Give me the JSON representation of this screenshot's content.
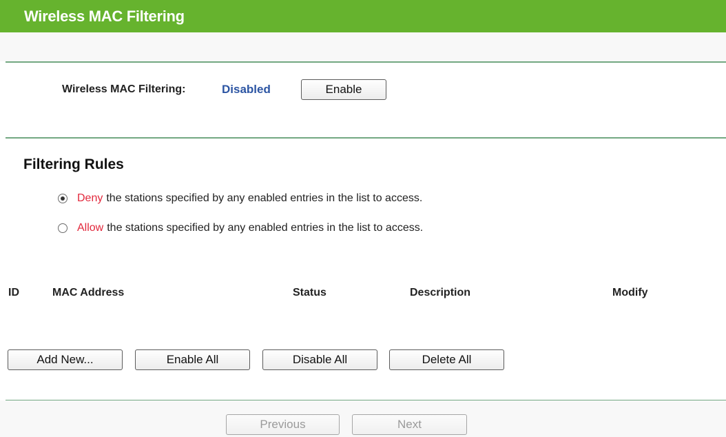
{
  "header": {
    "title": "Wireless MAC Filtering"
  },
  "filtering": {
    "label": "Wireless MAC Filtering:",
    "status": "Disabled",
    "enable_button": "Enable"
  },
  "rules": {
    "title": "Filtering Rules",
    "options": [
      {
        "keyword": "Deny",
        "text": "the stations specified by any enabled entries in the list to access.",
        "selected": true
      },
      {
        "keyword": "Allow",
        "text": "the stations specified by any enabled entries in the list to access.",
        "selected": false
      }
    ]
  },
  "table": {
    "columns": [
      "ID",
      "MAC Address",
      "Status",
      "Description",
      "Modify"
    ]
  },
  "actions": {
    "add_new": "Add New...",
    "enable_all": "Enable All",
    "disable_all": "Disable All",
    "delete_all": "Delete All"
  },
  "pager": {
    "previous": "Previous",
    "next": "Next"
  },
  "colors": {
    "header": "#66b32e",
    "status": "#2c55a3",
    "keyword": "#e2283c",
    "rule": "#72a881"
  }
}
